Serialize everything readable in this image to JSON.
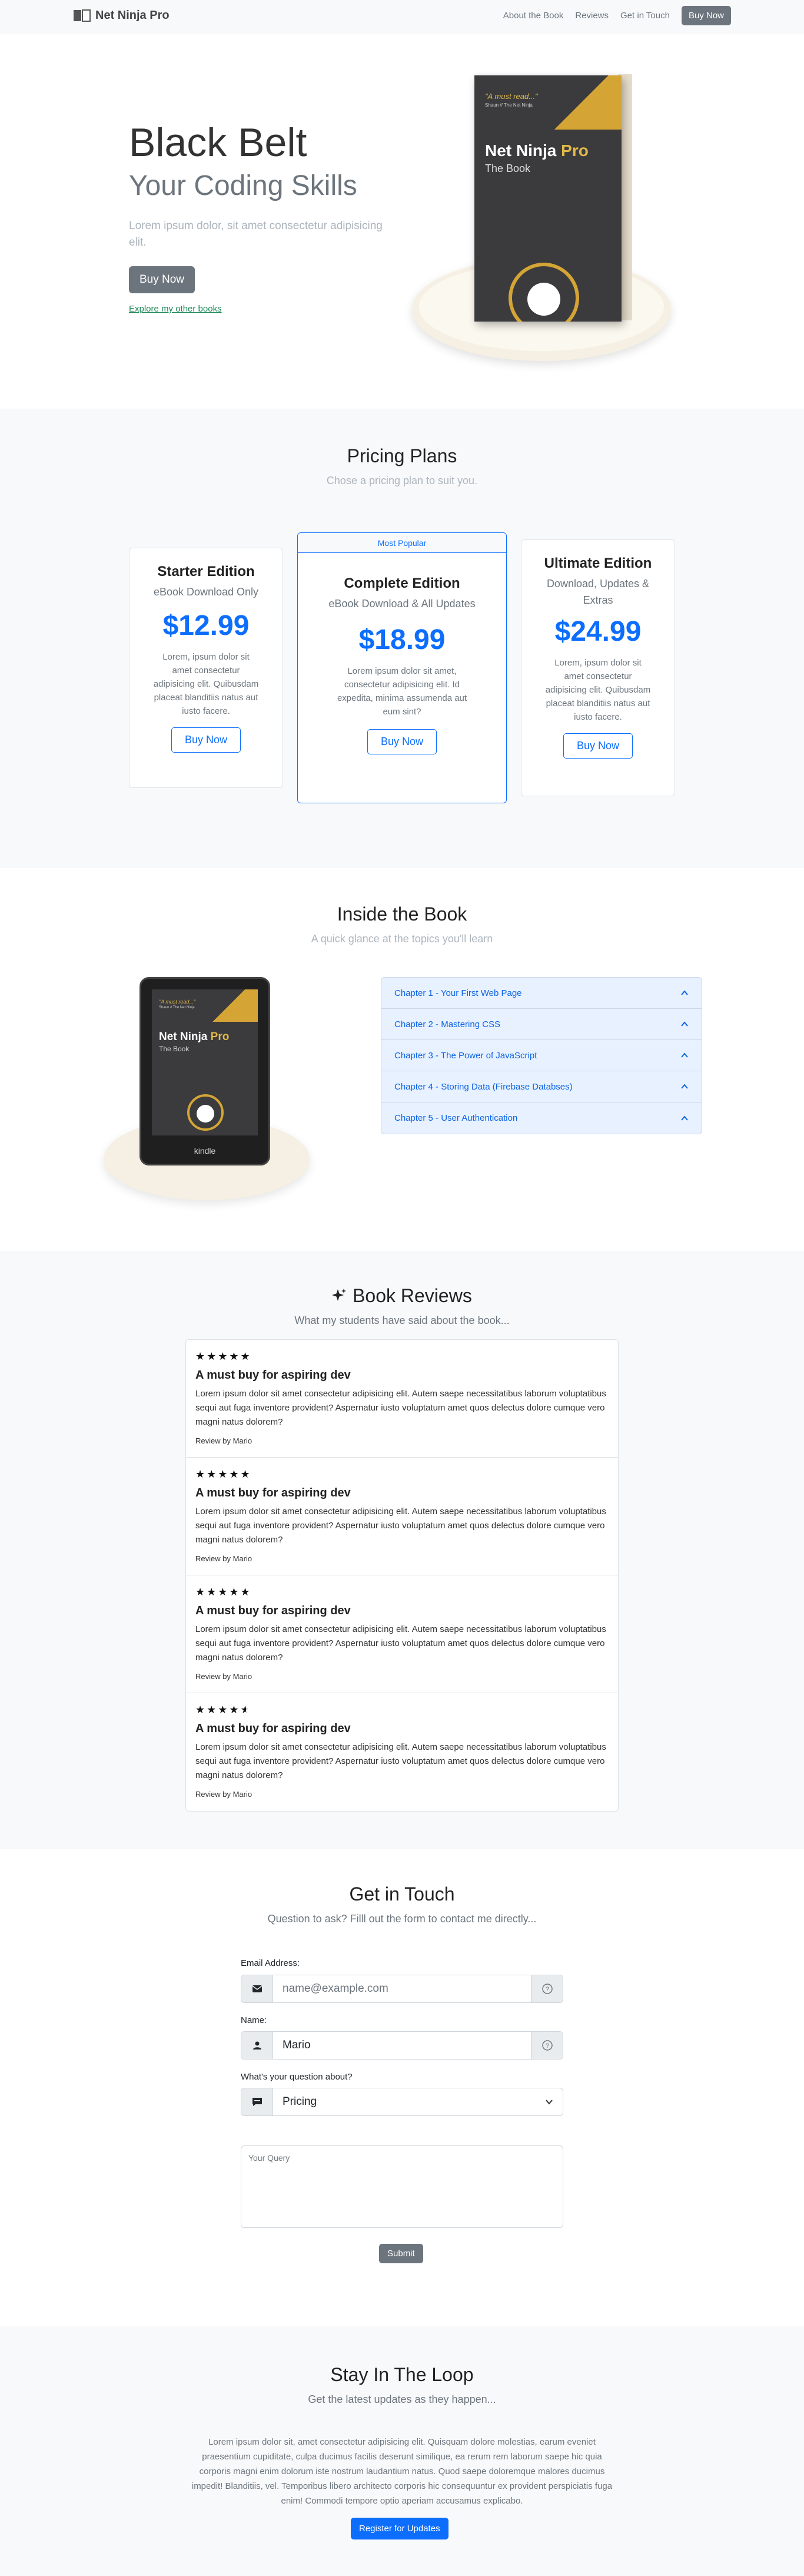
{
  "nav": {
    "brand": "Net Ninja Pro",
    "links": [
      "About the Book",
      "Reviews",
      "Get in Touch"
    ],
    "cta": "Buy Now"
  },
  "hero": {
    "title": "Black Belt",
    "subtitle": "Your Coding Skills",
    "lead": "Lorem ipsum dolor, sit amet consectetur adipisicing elit.",
    "buy": "Buy Now",
    "explore": "Explore my other books"
  },
  "book_cover": {
    "quote": "\"A must read...\"",
    "quote_by": "Shaun // The Net Ninja",
    "title_main": "Net Ninja",
    "title_pro": "Pro",
    "subtitle": "The Book",
    "device_label": "kindle"
  },
  "pricing": {
    "title": "Pricing Plans",
    "subtitle": "Chose a pricing plan to suit you.",
    "plans": [
      {
        "name": "Starter Edition",
        "sub": "eBook Download Only",
        "price": "$12.99",
        "desc": "Lorem, ipsum dolor sit amet consectetur adipisicing elit. Quibusdam placeat blanditiis natus aut iusto facere.",
        "cta": "Buy Now"
      },
      {
        "badge": "Most Popular",
        "name": "Complete Edition",
        "sub": "eBook Download & All Updates",
        "price": "$18.99",
        "desc": "Lorem ipsum dolor sit amet, consectetur adipisicing elit. Id expedita, minima assumenda aut eum sint?",
        "cta": "Buy Now"
      },
      {
        "name": "Ultimate Edition",
        "sub": "Download, Updates & Extras",
        "price": "$24.99",
        "desc": "Lorem, ipsum dolor sit amet consectetur adipisicing elit. Quibusdam placeat blanditiis natus aut iusto facere.",
        "cta": "Buy Now"
      }
    ]
  },
  "inside": {
    "title": "Inside the Book",
    "subtitle": "A quick glance at the topics you'll learn",
    "chapters": [
      "Chapter 1 - Your First Web Page",
      "Chapter 2 - Mastering CSS",
      "Chapter 3 - The Power of JavaScript",
      "Chapter 4 - Storing Data (Firebase Databses)",
      "Chapter 5 - User Authentication"
    ]
  },
  "reviews": {
    "title": "Book Reviews",
    "subtitle": "What my students have said about the book...",
    "items": [
      {
        "stars": 5,
        "heading": "A must buy for aspiring dev",
        "body": "Lorem ipsum dolor sit amet consectetur adipisicing elit. Autem saepe necessitatibus laborum voluptatibus sequi aut fuga inventore provident? Aspernatur iusto voluptatum amet quos delectus dolore cumque vero magni natus dolorem?",
        "by": "Review by Mario"
      },
      {
        "stars": 5,
        "heading": "A must buy for aspiring dev",
        "body": "Lorem ipsum dolor sit amet consectetur adipisicing elit. Autem saepe necessitatibus laborum voluptatibus sequi aut fuga inventore provident? Aspernatur iusto voluptatum amet quos delectus dolore cumque vero magni natus dolorem?",
        "by": "Review by Mario"
      },
      {
        "stars": 5,
        "heading": "A must buy for aspiring dev",
        "body": "Lorem ipsum dolor sit amet consectetur adipisicing elit. Autem saepe necessitatibus laborum voluptatibus sequi aut fuga inventore provident? Aspernatur iusto voluptatum amet quos delectus dolore cumque vero magni natus dolorem?",
        "by": "Review by Mario"
      },
      {
        "stars": 4.5,
        "heading": "A must buy for aspiring dev",
        "body": "Lorem ipsum dolor sit amet consectetur adipisicing elit. Autem saepe necessitatibus laborum voluptatibus sequi aut fuga inventore provident? Aspernatur iusto voluptatum amet quos delectus dolore cumque vero magni natus dolorem?",
        "by": "Review by Mario"
      }
    ]
  },
  "contact": {
    "title": "Get in Touch",
    "subtitle": "Question to ask? Filll out the form to contact me directly...",
    "email_label": "Email Address:",
    "email_placeholder": "name@example.com",
    "name_label": "Name:",
    "name_value": "Mario",
    "question_label": "What's your question about?",
    "question_selected": "Pricing",
    "query_placeholder": "Your Query",
    "submit": "Submit"
  },
  "newsletter": {
    "title": "Stay In The Loop",
    "subtitle": "Get the latest updates as they happen...",
    "body": "Lorem ipsum dolor sit, amet consectetur adipisicing elit. Quisquam dolore molestias, earum eveniet praesentium cupiditate, culpa ducimus facilis deserunt similique, ea rerum rem laborum saepe hic quia corporis magni enim dolorum iste nostrum laudantium natus. Quod saepe doloremque malores ducimus impedit! Blanditiis, vel. Temporibus libero architecto corporis hic consequuntur ex provident perspiciatis fuga enim! Commodi tempore optio aperiam accusamus explicabo.",
    "cta": "Register for Updates"
  },
  "colors": {
    "primary": "#0d6efd",
    "secondary": "#6c757d",
    "gold": "#d4a535"
  }
}
